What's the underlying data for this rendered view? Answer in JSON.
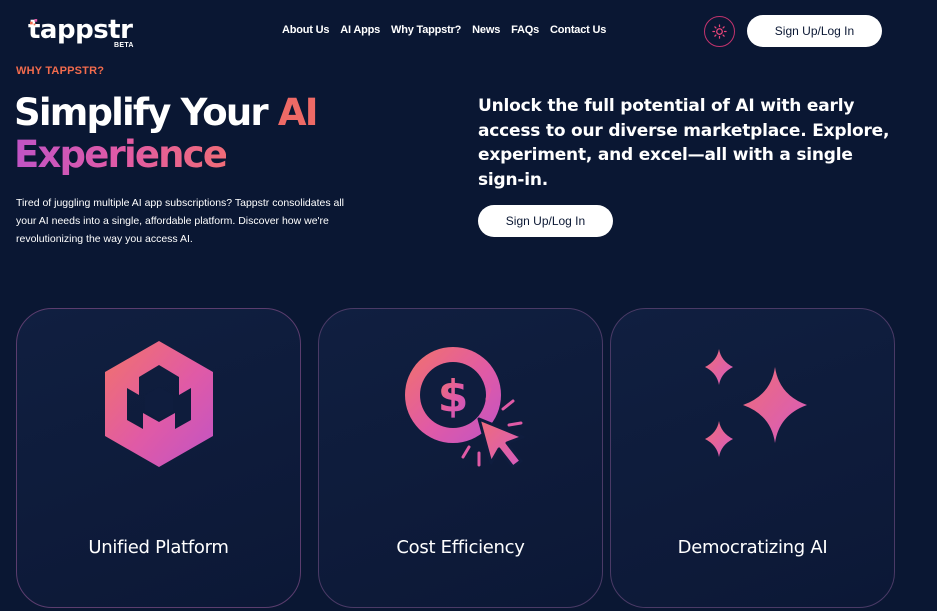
{
  "brand": {
    "name": "tappstr",
    "badge": "BETA"
  },
  "nav": {
    "items": [
      "About Us",
      "AI Apps",
      "Why Tappstr?",
      "News",
      "FAQs",
      "Contact Us"
    ]
  },
  "header": {
    "theme_toggle_icon": "sun-icon",
    "signup_label": "Sign Up/Log In"
  },
  "hero": {
    "eyebrow": "WHY TAPPSTR?",
    "headline_part1": "Simplify Your ",
    "headline_ai": "AI",
    "headline_part2": "Experience",
    "description": "Tired of juggling multiple AI app subscriptions? Tappstr consolidates all your AI needs into a single, affordable platform. Discover how we're revolutionizing the way you access AI.",
    "lead": "Unlock the full potential of AI with early access to our diverse marketplace. Explore, experiment, and excel—all with a single sign-in.",
    "cta_label": "Sign Up/Log In"
  },
  "features": [
    {
      "title": "Unified Platform",
      "icon": "cube-icon"
    },
    {
      "title": "Cost Efficiency",
      "icon": "dollar-click-icon"
    },
    {
      "title": "Democratizing AI",
      "icon": "sparkles-icon"
    }
  ],
  "colors": {
    "background": "#0a1733",
    "accent_orange": "#f26b4d",
    "accent_pink": "#e05aa6",
    "accent_purple": "#c054c6",
    "button_bg": "#ffffff"
  }
}
